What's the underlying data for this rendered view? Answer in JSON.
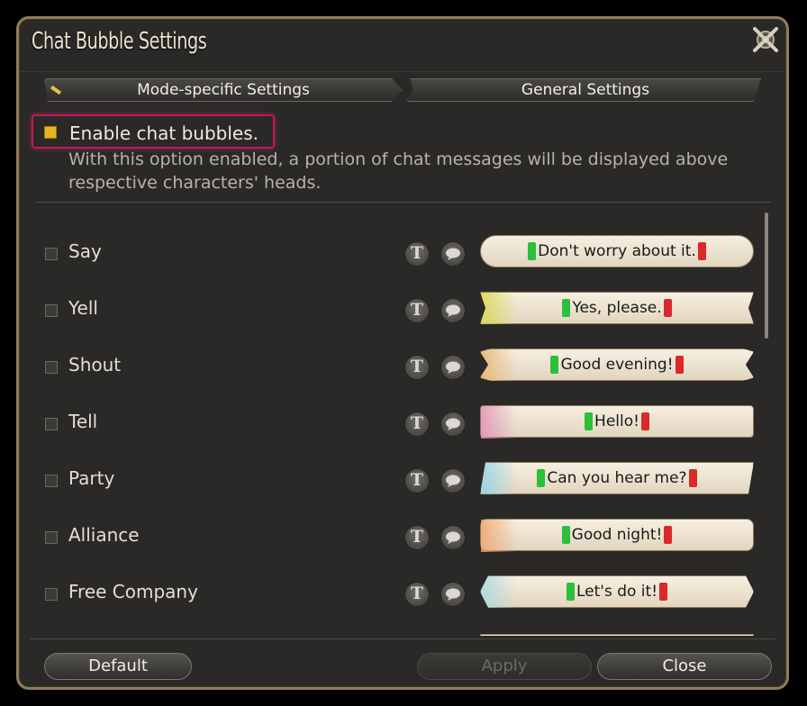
{
  "window": {
    "title": "Chat Bubble Settings"
  },
  "tabs": [
    {
      "label": "Mode-specific Settings",
      "active": true
    },
    {
      "label": "General Settings",
      "active": false
    }
  ],
  "enable": {
    "label": "Enable chat bubbles.",
    "checked": true,
    "description": "With this option enabled, a portion of chat messages will be displayed above respective characters' heads."
  },
  "channels": [
    {
      "name": "Say",
      "preview": "Don't worry about it.",
      "accent": ""
    },
    {
      "name": "Yell",
      "preview": "Yes, please.",
      "accent": "#d9d84a"
    },
    {
      "name": "Shout",
      "preview": "Good evening!",
      "accent": "#e8b46a"
    },
    {
      "name": "Tell",
      "preview": "Hello!",
      "accent": "#e290b8"
    },
    {
      "name": "Party",
      "preview": "Can you hear me?",
      "accent": "#8ed3e6"
    },
    {
      "name": "Alliance",
      "preview": "Good night!",
      "accent": "#f0a46c"
    },
    {
      "name": "Free Company",
      "preview": "Let's do it!",
      "accent": "#a8d8e0"
    }
  ],
  "footer": {
    "default_label": "Default",
    "apply_label": "Apply",
    "close_label": "Close"
  },
  "icons": {
    "close": "close-icon",
    "text_style": "text-style-icon",
    "bubble_style": "speech-bubble-icon"
  }
}
